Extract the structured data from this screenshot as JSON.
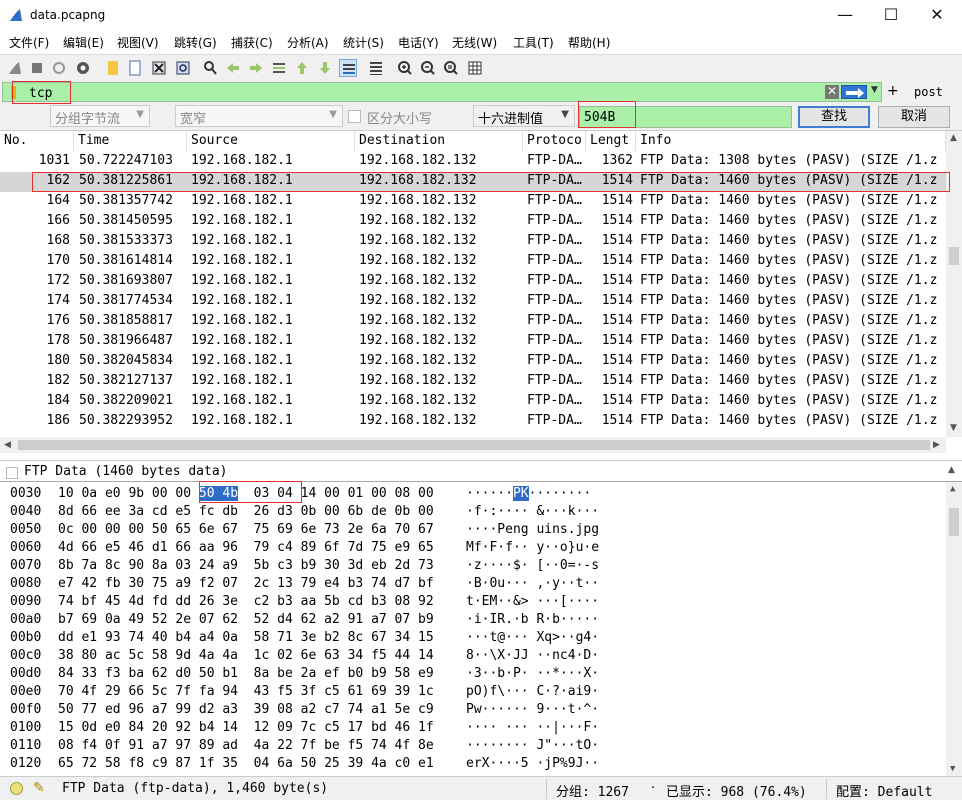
{
  "window": {
    "title": "data.pcapng"
  },
  "menu": [
    "文件(F)",
    "编辑(E)",
    "视图(V)",
    "跳转(G)",
    "捕获(C)",
    "分析(A)",
    "统计(S)",
    "电话(Y)",
    "无线(W)",
    "工具(T)",
    "帮助(H)"
  ],
  "toolbar_icons": [
    "shark-fin-start-icon",
    "stop-icon",
    "restart-icon",
    "capture-options-icon",
    "open-file-icon",
    "file-icon",
    "close-file-icon",
    "reload-icon",
    "find-packet-icon",
    "go-back-icon",
    "go-forward-icon",
    "go-to-packet-icon",
    "go-first-icon",
    "go-last-icon",
    "autoscroll-icon",
    "colorize-icon",
    "zoom-in-icon",
    "zoom-out-icon",
    "zoom-normal-icon",
    "resize-columns-icon"
  ],
  "filter": {
    "value": "tcp",
    "expression_button": "post"
  },
  "search": {
    "scope": "分组字节流",
    "width": "宽窄",
    "case_sensitive_label": "区分大小写",
    "type": "十六进制值",
    "value": "504B",
    "find_label": "查找",
    "cancel_label": "取消"
  },
  "columns": [
    "No.",
    "Time",
    "Source",
    "Destination",
    "Protoco",
    "Lengt",
    "Info"
  ],
  "packets": [
    {
      "no": "1031",
      "time": "50.722247103",
      "src": "192.168.182.1",
      "dst": "192.168.182.132",
      "proto": "FTP-DA…",
      "len": "1362",
      "info": "FTP Data: 1308 bytes (PASV) (SIZE /1.z"
    },
    {
      "no": "162",
      "time": "50.381225861",
      "src": "192.168.182.1",
      "dst": "192.168.182.132",
      "proto": "FTP-DA…",
      "len": "1514",
      "info": "FTP Data: 1460 bytes (PASV) (SIZE /1.z"
    },
    {
      "no": "164",
      "time": "50.381357742",
      "src": "192.168.182.1",
      "dst": "192.168.182.132",
      "proto": "FTP-DA…",
      "len": "1514",
      "info": "FTP Data: 1460 bytes (PASV) (SIZE /1.z"
    },
    {
      "no": "166",
      "time": "50.381450595",
      "src": "192.168.182.1",
      "dst": "192.168.182.132",
      "proto": "FTP-DA…",
      "len": "1514",
      "info": "FTP Data: 1460 bytes (PASV) (SIZE /1.z"
    },
    {
      "no": "168",
      "time": "50.381533373",
      "src": "192.168.182.1",
      "dst": "192.168.182.132",
      "proto": "FTP-DA…",
      "len": "1514",
      "info": "FTP Data: 1460 bytes (PASV) (SIZE /1.z"
    },
    {
      "no": "170",
      "time": "50.381614814",
      "src": "192.168.182.1",
      "dst": "192.168.182.132",
      "proto": "FTP-DA…",
      "len": "1514",
      "info": "FTP Data: 1460 bytes (PASV) (SIZE /1.z"
    },
    {
      "no": "172",
      "time": "50.381693807",
      "src": "192.168.182.1",
      "dst": "192.168.182.132",
      "proto": "FTP-DA…",
      "len": "1514",
      "info": "FTP Data: 1460 bytes (PASV) (SIZE /1.z"
    },
    {
      "no": "174",
      "time": "50.381774534",
      "src": "192.168.182.1",
      "dst": "192.168.182.132",
      "proto": "FTP-DA…",
      "len": "1514",
      "info": "FTP Data: 1460 bytes (PASV) (SIZE /1.z"
    },
    {
      "no": "176",
      "time": "50.381858817",
      "src": "192.168.182.1",
      "dst": "192.168.182.132",
      "proto": "FTP-DA…",
      "len": "1514",
      "info": "FTP Data: 1460 bytes (PASV) (SIZE /1.z"
    },
    {
      "no": "178",
      "time": "50.381966487",
      "src": "192.168.182.1",
      "dst": "192.168.182.132",
      "proto": "FTP-DA…",
      "len": "1514",
      "info": "FTP Data: 1460 bytes (PASV) (SIZE /1.z"
    },
    {
      "no": "180",
      "time": "50.382045834",
      "src": "192.168.182.1",
      "dst": "192.168.182.132",
      "proto": "FTP-DA…",
      "len": "1514",
      "info": "FTP Data: 1460 bytes (PASV) (SIZE /1.z"
    },
    {
      "no": "182",
      "time": "50.382127137",
      "src": "192.168.182.1",
      "dst": "192.168.182.132",
      "proto": "FTP-DA…",
      "len": "1514",
      "info": "FTP Data: 1460 bytes (PASV) (SIZE /1.z"
    },
    {
      "no": "184",
      "time": "50.382209021",
      "src": "192.168.182.1",
      "dst": "192.168.182.132",
      "proto": "FTP-DA…",
      "len": "1514",
      "info": "FTP Data: 1460 bytes (PASV) (SIZE /1.z"
    },
    {
      "no": "186",
      "time": "50.382293952",
      "src": "192.168.182.1",
      "dst": "192.168.182.132",
      "proto": "FTP-DA…",
      "len": "1514",
      "info": "FTP Data: 1460 bytes (PASV) (SIZE /1.z"
    }
  ],
  "selected_packet_index": 1,
  "detail_line": "FTP Data (1460 bytes data)",
  "hex_rows": [
    {
      "offset": "0030",
      "pre": "10 0a e0 9b 00 00 ",
      "hl": "50 4b",
      "post": "  03 04 14 00 01 00 08 00",
      "ascii_pre": "······",
      "ascii_hl": "PK",
      "ascii_post": "········"
    },
    {
      "offset": "0040",
      "pre": "8d 66 ee 3a cd e5 fc db  26 d3 0b 00 6b de 0b 00",
      "ascii_pre": "·f·:···· &···k···"
    },
    {
      "offset": "0050",
      "pre": "0c 00 00 00 50 65 6e 67  75 69 6e 73 2e 6a 70 67",
      "ascii_pre": "····Peng uins.jpg"
    },
    {
      "offset": "0060",
      "pre": "4d 66 e5 46 d1 66 aa 96  79 c4 89 6f 7d 75 e9 65",
      "ascii_pre": "Mf·F·f·· y··o}u·e"
    },
    {
      "offset": "0070",
      "pre": "8b 7a 8c 90 8a 03 24 a9  5b c3 b9 30 3d eb 2d 73",
      "ascii_pre": "·z····$· [··0=·-s"
    },
    {
      "offset": "0080",
      "pre": "e7 42 fb 30 75 a9 f2 07  2c 13 79 e4 b3 74 d7 bf",
      "ascii_pre": "·B·0u··· ,·y··t··"
    },
    {
      "offset": "0090",
      "pre": "74 bf 45 4d fd dd 26 3e  c2 b3 aa 5b cd b3 08 92",
      "ascii_pre": "t·EM··&> ···[····"
    },
    {
      "offset": "00a0",
      "pre": "b7 69 0a 49 52 2e 07 62  52 d4 62 a2 91 a7 07 b9",
      "ascii_pre": "·i·IR.·b R·b·····"
    },
    {
      "offset": "00b0",
      "pre": "dd e1 93 74 40 b4 a4 0a  58 71 3e b2 8c 67 34 15",
      "ascii_pre": "···t@··· Xq>··g4·"
    },
    {
      "offset": "00c0",
      "pre": "38 80 ac 5c 58 9d 4a 4a  1c 02 6e 63 34 f5 44 14",
      "ascii_pre": "8··\\X·JJ ··nc4·D·"
    },
    {
      "offset": "00d0",
      "pre": "84 33 f3 ba 62 d0 50 b1  8a be 2a ef b0 b9 58 e9",
      "ascii_pre": "·3··b·P· ··*···X·"
    },
    {
      "offset": "00e0",
      "pre": "70 4f 29 66 5c 7f fa 94  43 f5 3f c5 61 69 39 1c",
      "ascii_pre": "pO)f\\··· C·?·ai9·"
    },
    {
      "offset": "00f0",
      "pre": "50 77 ed 96 a7 99 d2 a3  39 08 a2 c7 74 a1 5e c9",
      "ascii_pre": "Pw······ 9···t·^·"
    },
    {
      "offset": "0100",
      "pre": "15 0d e0 84 20 92 b4 14  12 09 7c c5 17 bd 46 1f",
      "ascii_pre": "···· ··· ··|···F·"
    },
    {
      "offset": "0110",
      "pre": "08 f4 0f 91 a7 97 89 ad  4a 22 7f be f5 74 4f 8e",
      "ascii_pre": "········ J\"···tO·"
    },
    {
      "offset": "0120",
      "pre": "65 72 58 f8 c9 87 1f 35  04 6a 50 25 39 4a c0 e1",
      "ascii_pre": "erX····5 ·jP%9J··"
    }
  ],
  "status": {
    "text": "FTP Data (ftp-data), 1,460 byte(s)",
    "packets": "分组: 1267",
    "displayed": "已显示: 968 (76.4%)",
    "profile": "配置: Default"
  },
  "colors": {
    "filter_bg": "#aaf0a8",
    "selection_bg": "#d6d6d6",
    "highlight_bg": "#2f6cc8",
    "annotation_red": "#e03030"
  }
}
